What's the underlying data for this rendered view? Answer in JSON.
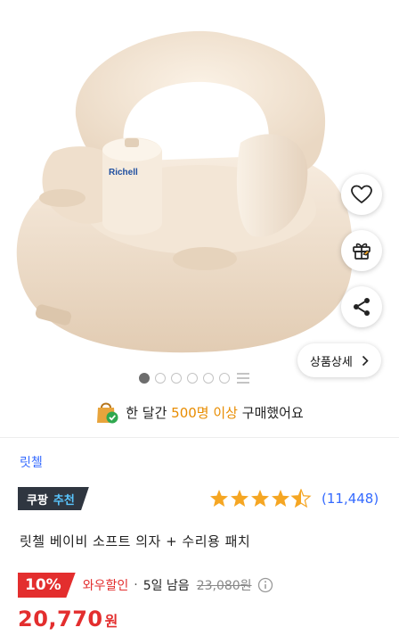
{
  "gallery": {
    "image_alt": "",
    "dot_count": 6,
    "active_index": 0,
    "detail_button_label": "상품상세",
    "chevron_icon": "chevron-right-icon"
  },
  "actions": {
    "wishlist_icon": "heart-icon",
    "gift_icon": "gift-icon",
    "share_icon": "share-icon"
  },
  "purchase_banner": {
    "prefix": "한 달간",
    "highlight": "500명 이상",
    "suffix": "구매했어요",
    "icon": "shopping-bag-check-icon"
  },
  "product": {
    "brand": "릿첼",
    "badge_part1": "쿠팡",
    "badge_part2": "추천",
    "rating_stars": 4.5,
    "review_count": "(11,448)",
    "title": "릿첼 베이비 소프트 의자 + 수리용 패치"
  },
  "price": {
    "discount_rate": "10%",
    "deal_label": "와우할인",
    "separator": "·",
    "days_left": "5일 남음",
    "original_price": "23,080원",
    "final_price": "20,770",
    "currency": "원"
  },
  "colors": {
    "accent_blue": "#346aff",
    "sale_red": "#e32e2e",
    "highlight_orange": "#e88c00",
    "badge_dark": "#2f3640",
    "badge_blue": "#59c6ff",
    "star_orange": "#f5a623"
  }
}
